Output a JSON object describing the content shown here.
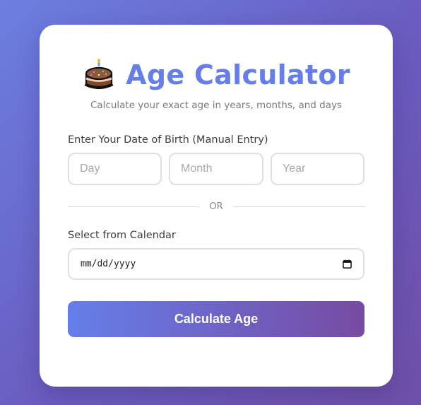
{
  "header": {
    "icon": "birthday-cake-icon",
    "title": "Age Calculator",
    "subtitle": "Calculate your exact age in years, months, and days"
  },
  "manual_entry": {
    "label": "Enter Your Date of Birth (Manual Entry)",
    "day_placeholder": "Day",
    "month_placeholder": "Month",
    "year_placeholder": "Year"
  },
  "divider": {
    "text": "OR"
  },
  "calendar": {
    "label": "Select from Calendar",
    "value_display": "mm/dd/yyyy",
    "icon": "calendar-icon"
  },
  "actions": {
    "calculate_label": "Calculate Age"
  },
  "colors": {
    "accent": "#667eea",
    "gradient_end": "#764ba2",
    "background": "#6a5bbf"
  }
}
